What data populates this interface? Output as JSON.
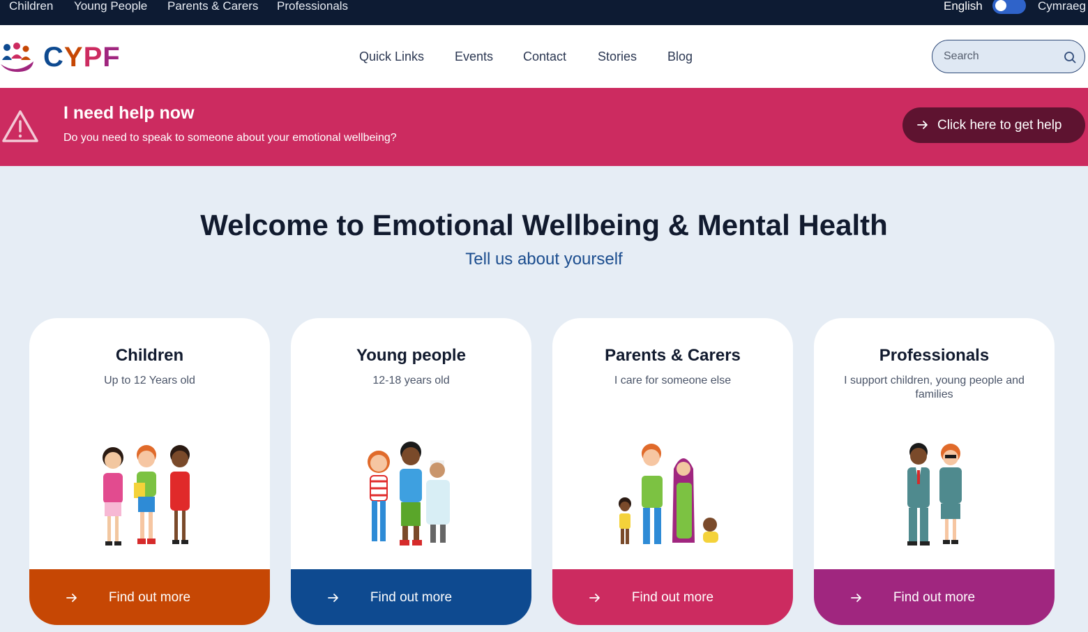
{
  "topbar": {
    "audiences": [
      "Children",
      "Young People",
      "Parents & Carers",
      "Professionals"
    ],
    "lang_current": "English",
    "lang_alt": "Cymraeg"
  },
  "header": {
    "logo_text": "CYPF",
    "nav": [
      "Quick Links",
      "Events",
      "Contact",
      "Stories",
      "Blog"
    ],
    "search_placeholder": "Search"
  },
  "help": {
    "title": "I need help now",
    "subtitle": "Do you need to speak to someone about your emotional wellbeing?",
    "button_label": "Click here to get help"
  },
  "welcome": {
    "title": "Welcome to Emotional Wellbeing & Mental Health",
    "subtitle": "Tell us about yourself"
  },
  "cards": [
    {
      "title": "Children",
      "subtitle": "Up to 12 Years old",
      "cta": "Find out more",
      "color": "#c64704"
    },
    {
      "title": "Young people",
      "subtitle": "12-18 years old",
      "cta": "Find out more",
      "color": "#0e4a90"
    },
    {
      "title": "Parents & Carers",
      "subtitle": "I care for someone else",
      "cta": "Find out more",
      "color": "#cc2b60"
    },
    {
      "title": "Professionals",
      "subtitle": "I support children, young people and families",
      "cta": "Find out more",
      "color": "#a0267f"
    }
  ],
  "colors": {
    "topbar": "#0d1b33",
    "help_band": "#cc2b60",
    "help_button": "#5e1330",
    "page_bg": "#e6edf5",
    "logo_c": "#0e4a90",
    "logo_y": "#c64704",
    "logo_p": "#cc2b60",
    "logo_f": "#a0267f"
  },
  "icons": [
    "family-logo-icon",
    "search-icon",
    "warning-icon",
    "arrow-right-icon",
    "people-illustration"
  ]
}
